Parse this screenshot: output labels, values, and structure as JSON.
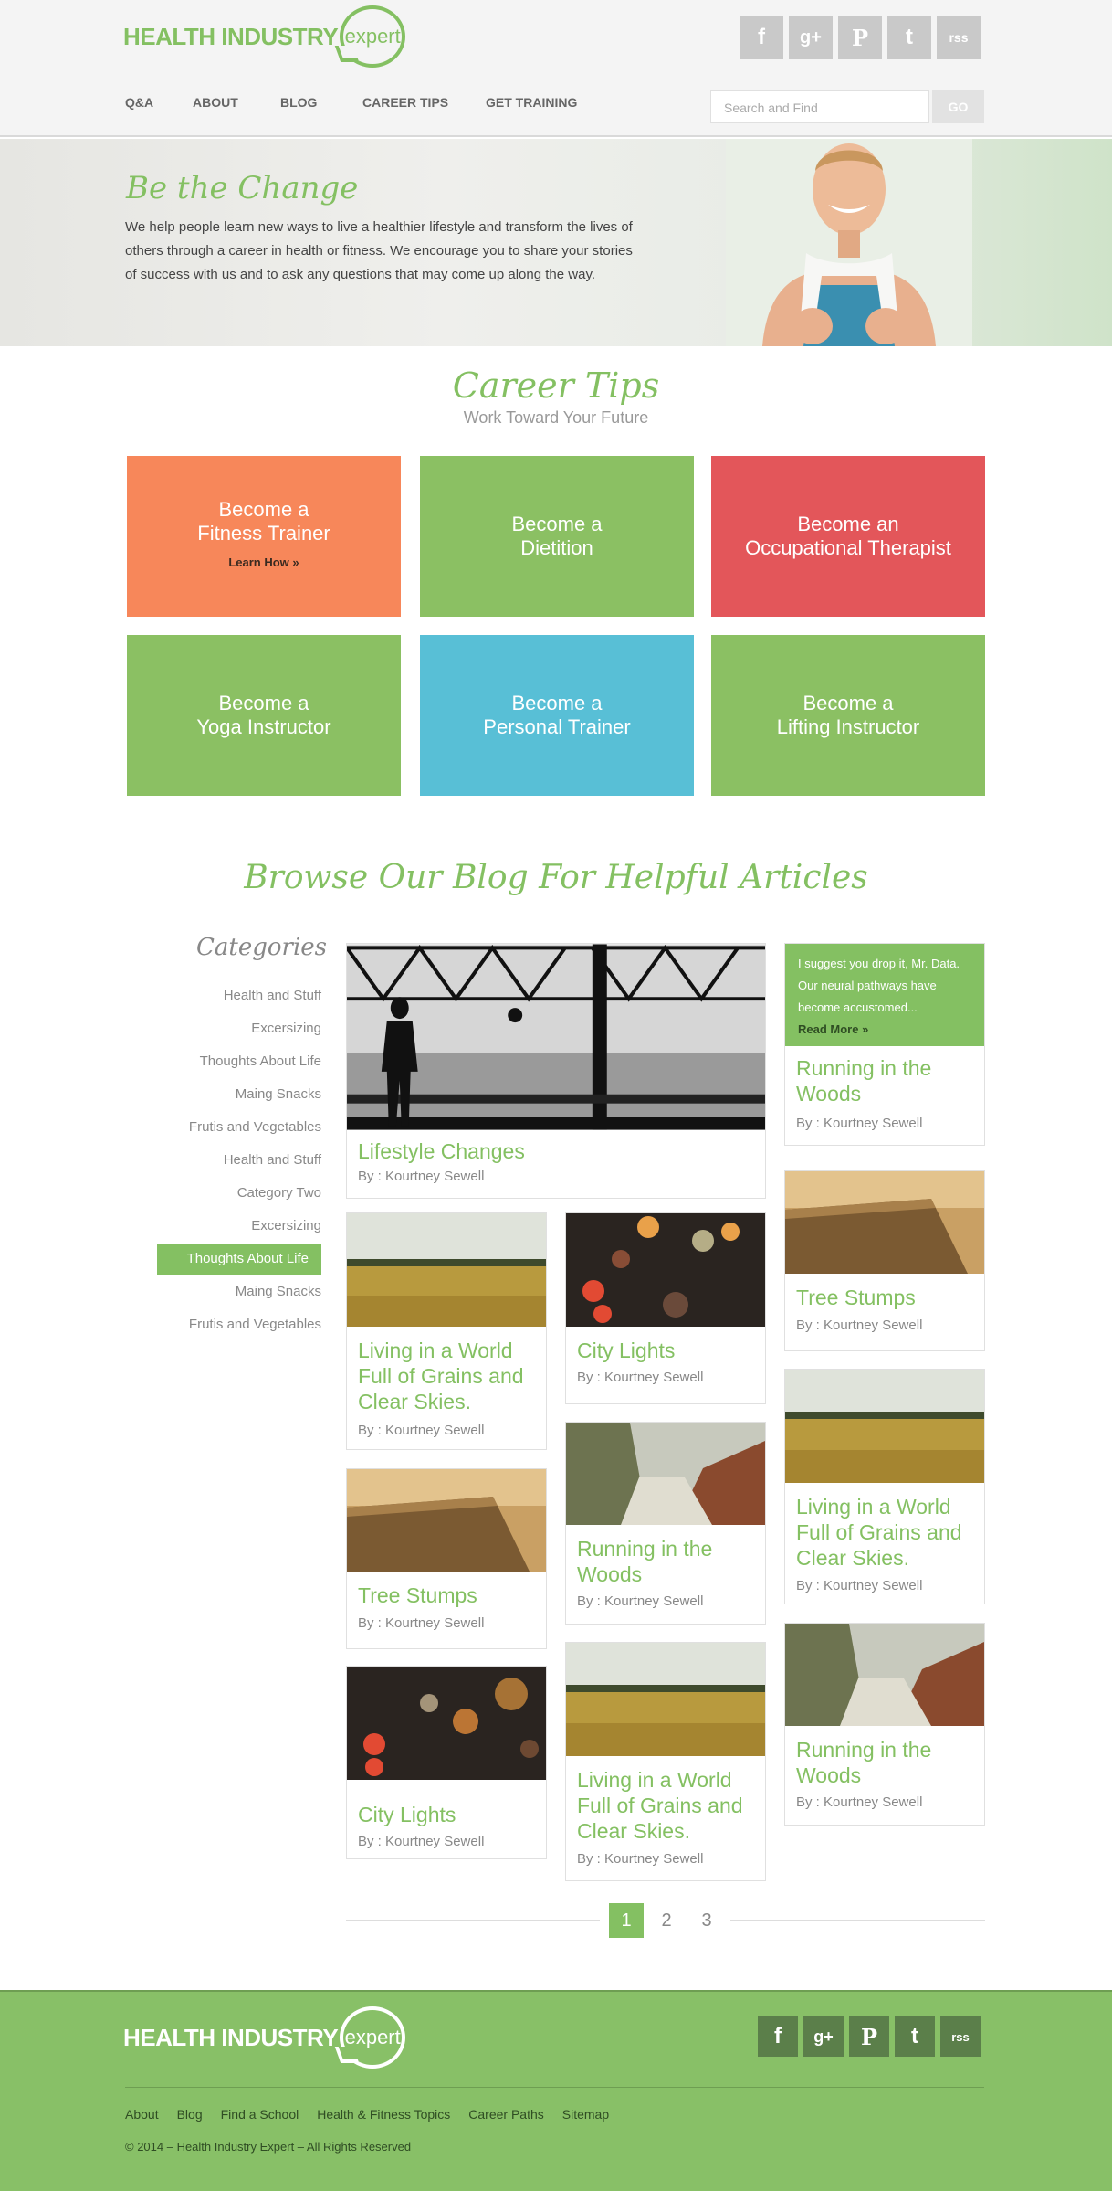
{
  "header": {
    "logo": {
      "main": "HEALTH INDUSTRY",
      "bubble": "expert"
    },
    "social": [
      {
        "name": "facebook",
        "glyph": "f"
      },
      {
        "name": "google-plus",
        "glyph": "g+"
      },
      {
        "name": "pinterest",
        "glyph": "P"
      },
      {
        "name": "twitter",
        "glyph": "t"
      },
      {
        "name": "rss",
        "glyph": "rss"
      }
    ],
    "nav": [
      "Q&A",
      "ABOUT",
      "BLOG",
      "CAREER TIPS",
      "GET TRAINING"
    ],
    "search": {
      "placeholder": "Search and Find",
      "button": "GO"
    }
  },
  "hero": {
    "title": "Be the Change",
    "text": "We help people learn new ways to live a healthier lifestyle and transform the lives of others through a career in health or fitness. We encourage you to share your stories of success with us and to ask any questions that may come up along the way."
  },
  "career": {
    "title": "Career Tips",
    "subtitle": "Work Toward Your Future",
    "tiles": [
      {
        "l1": "Become a",
        "l2": "Fitness Trainer",
        "cta": "Learn How »",
        "color": "#f7875a"
      },
      {
        "l1": "Become a",
        "l2": "Dietition",
        "color": "#8bc063"
      },
      {
        "l1": "Become an",
        "l2": "Occupational Therapist",
        "color": "#e3565a"
      },
      {
        "l1": "Become a",
        "l2": "Yoga Instructor",
        "color": "#8bc063"
      },
      {
        "l1": "Become a",
        "l2": "Personal Trainer",
        "color": "#58bfd6"
      },
      {
        "l1": "Become a",
        "l2": "Lifting Instructor",
        "color": "#8bc063"
      }
    ]
  },
  "blog": {
    "title": "Browse Our Blog For Helpful Articles",
    "categories_title": "Categories",
    "categories": [
      "Health and Stuff",
      "Excersizing",
      "Thoughts About Life",
      "Maing Snacks",
      "Frutis and Vegetables",
      "Health and Stuff",
      "Category Two",
      "Excersizing",
      "Thoughts About Life",
      "Maing Snacks",
      "Frutis and Vegetables"
    ],
    "active_category": 8,
    "featured": {
      "title": "Lifestyle Changes",
      "by": "By : Kourtney Sewell"
    },
    "quote": {
      "text": "I suggest you drop it, Mr. Data. Our neural pathways have become accustomed...",
      "cta": "Read More »"
    },
    "cards": [
      {
        "title": "Running in the Woods",
        "by": "By : Kourtney Sewell"
      },
      {
        "title": "Living in a World Full of Grains and Clear Skies.",
        "by": "By : Kourtney Sewell"
      },
      {
        "title": "City Lights",
        "by": "By : Kourtney Sewell"
      },
      {
        "title": "Tree Stumps",
        "by": "By : Kourtney Sewell"
      },
      {
        "title": "Tree Stumps",
        "by": "By : Kourtney Sewell"
      },
      {
        "title": "Running in the Woods",
        "by": "By : Kourtney Sewell"
      },
      {
        "title": "Living in a World Full of Grains and Clear Skies.",
        "by": "By : Kourtney Sewell"
      },
      {
        "title": "City Lights",
        "by": "By : Kourtney Sewell"
      },
      {
        "title": "Living in a World Full of Grains and Clear Skies.",
        "by": "By : Kourtney Sewell"
      },
      {
        "title": "Running in the Woods",
        "by": "By : Kourtney Sewell"
      }
    ],
    "pages": [
      "1",
      "2",
      "3"
    ]
  },
  "footer": {
    "links": [
      "About",
      "Blog",
      "Find a School",
      "Health & Fitness Topics",
      "Career Paths",
      "Sitemap"
    ],
    "copyright": "© 2014 – Health Industry Expert – All Rights Reserved"
  },
  "colors": {
    "accent": "#84c062",
    "orange": "#f7875a",
    "red": "#e3565a",
    "blue": "#58bfd6"
  }
}
